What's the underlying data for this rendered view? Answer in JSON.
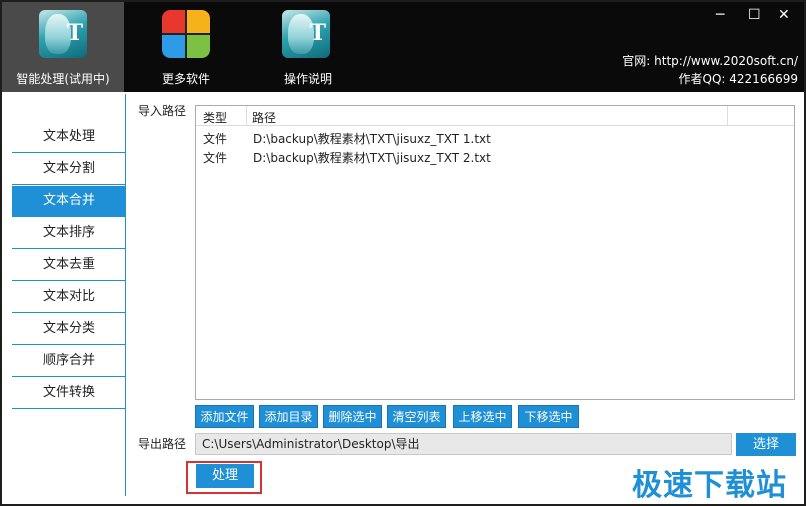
{
  "top_buttons": [
    {
      "label": "智能处理(试用中)",
      "icon": "portrait-t-icon"
    },
    {
      "label": "更多软件",
      "icon": "apps-grid-icon"
    },
    {
      "label": "操作说明",
      "icon": "portrait-t-icon"
    }
  ],
  "window_controls": {
    "minimize": "─",
    "maximize": "☐",
    "close": "✕"
  },
  "site": {
    "website": "官网: http://www.2020soft.cn/",
    "qq": "作者QQ: 422166699"
  },
  "sidebar": {
    "items": [
      "文本处理",
      "文本分割",
      "文本合并",
      "文本排序",
      "文本去重",
      "文本对比",
      "文本分类",
      "顺序合并",
      "文件转换"
    ],
    "active_index": 2
  },
  "import": {
    "label": "导入路径",
    "columns": [
      "类型",
      "路径"
    ],
    "rows": [
      {
        "type": "文件",
        "path": "D:\\backup\\教程素材\\TXT\\jisuxz_TXT 1.txt"
      },
      {
        "type": "文件",
        "path": "D:\\backup\\教程素材\\TXT\\jisuxz_TXT 2.txt"
      }
    ]
  },
  "actions": [
    "添加文件",
    "添加目录",
    "删除选中",
    "清空列表",
    "上移选中",
    "下移选中"
  ],
  "export": {
    "label": "导出路径",
    "value": "C:\\Users\\Administrator\\Desktop\\导出",
    "select_label": "选择"
  },
  "process_label": "处理",
  "watermark": "极速下载站",
  "colors": {
    "accent": "#1f8fd6",
    "topbar": "#0a0a0a",
    "highlight": "#d63333"
  }
}
